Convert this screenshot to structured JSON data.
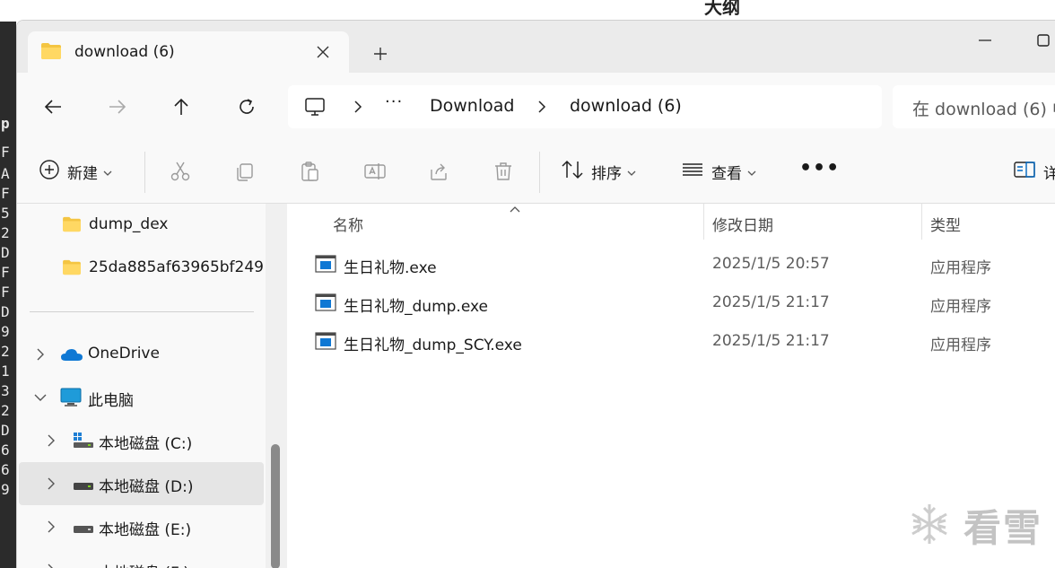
{
  "background": {
    "title_fragment": "大纲",
    "terminal_chars": [
      "F",
      "p",
      "A",
      "F",
      "5",
      "2",
      "D",
      "F",
      "F",
      "D",
      "9",
      "2",
      "1",
      "3",
      "2",
      "D",
      "6",
      "6",
      "9"
    ]
  },
  "window": {
    "tab": {
      "label": "download (6)",
      "icon": "folder-icon"
    },
    "new_tab_icon": "plus-icon",
    "controls": {
      "minimize": "minimize-icon",
      "maximize": "maximize-icon"
    }
  },
  "nav": {
    "back_icon": "arrow-left-icon",
    "forward_icon": "arrow-right-icon",
    "up_icon": "arrow-up-icon",
    "refresh_icon": "refresh-icon",
    "breadcrumb": {
      "root_icon": "this-pc-icon",
      "more": "···",
      "items": [
        "Download",
        "download (6)"
      ]
    },
    "search_placeholder": "在 download (6) 中"
  },
  "commands": {
    "new_label": "新建",
    "sort_label": "排序",
    "view_label": "查看",
    "more": "•••",
    "details_label": "详"
  },
  "sidebar": {
    "items": [
      {
        "label": "dump_dex",
        "icon": "folder-icon",
        "indent": 1,
        "chevron": false
      },
      {
        "label": "25da885af63965bf249",
        "icon": "folder-icon",
        "indent": 1,
        "chevron": false
      },
      {
        "label": "OneDrive",
        "icon": "cloud-icon",
        "indent": 0,
        "chevron": "right"
      },
      {
        "label": "此电脑",
        "icon": "monitor-icon",
        "indent": 0,
        "chevron": "down"
      },
      {
        "label": "本地磁盘 (C:)",
        "icon": "windows-drive-icon",
        "indent": 1,
        "chevron": "right"
      },
      {
        "label": "本地磁盘 (D:)",
        "icon": "drive-icon",
        "indent": 1,
        "chevron": "right",
        "selected": true
      },
      {
        "label": "本地磁盘 (E:)",
        "icon": "drive-icon",
        "indent": 1,
        "chevron": "right"
      },
      {
        "label": "本地磁盘 (F:)",
        "icon": "drive-icon",
        "indent": 1,
        "chevron": "right"
      }
    ]
  },
  "file_list": {
    "columns": [
      "名称",
      "修改日期",
      "类型"
    ],
    "rows": [
      {
        "name": "生日礼物.exe",
        "modified": "2025/1/5 20:57",
        "type": "应用程序"
      },
      {
        "name": "生日礼物_dump.exe",
        "modified": "2025/1/5 21:17",
        "type": "应用程序"
      },
      {
        "name": "生日礼物_dump_SCY.exe",
        "modified": "2025/1/5 21:17",
        "type": "应用程序"
      }
    ]
  },
  "watermark": {
    "text": "看雪"
  },
  "colors": {
    "accent": "#0067c0",
    "folder": "#f4c542",
    "selected": "#e5e5e5"
  }
}
